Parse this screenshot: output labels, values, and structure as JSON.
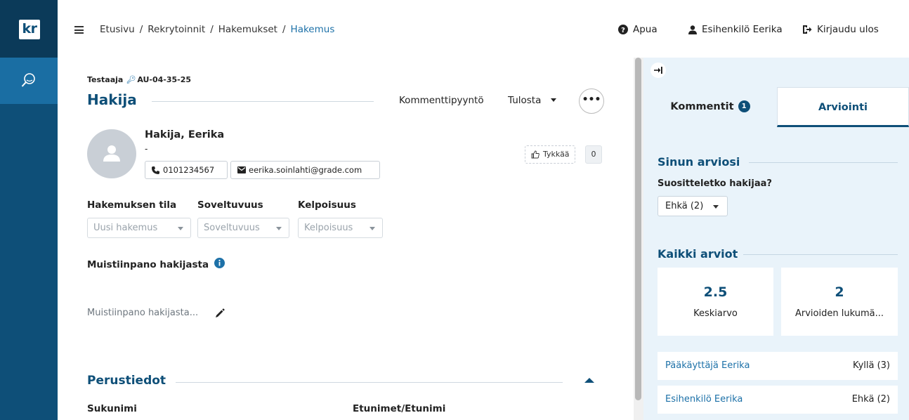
{
  "app": {
    "logo_text": "kr"
  },
  "breadcrumb": {
    "items": [
      "Etusivu",
      "Rekrytoinnit",
      "Hakemukset"
    ],
    "separator": "/",
    "current": "Hakemus"
  },
  "header": {
    "help_label": "Apua",
    "user_label": "Esihenkilö Eerika",
    "logout_label": "Kirjaudu ulos"
  },
  "applicant": {
    "role_label": "Testaaja",
    "code": "AU-04-35-25",
    "section_title": "Hakija",
    "request_comment_label": "Kommenttipyyntö",
    "print_label": "Tulosta",
    "more_label": "•••",
    "name": "Hakija, Eerika",
    "subtitle": "-",
    "phone": "0101234567",
    "email": "eerika.soinlahti@grade.com",
    "like_label": "Tykkää",
    "like_count": "0"
  },
  "status_fields": [
    {
      "label": "Hakemuksen tila",
      "placeholder": "Uusi hakemus"
    },
    {
      "label": "Soveltuvuus",
      "placeholder": "Soveltuvuus"
    },
    {
      "label": "Kelpoisuus",
      "placeholder": "Kelpoisuus"
    }
  ],
  "note": {
    "label": "Muistiinpano hakijasta",
    "placeholder": "Muistiinpano hakijasta..."
  },
  "basic_info": {
    "title": "Perustiedot",
    "columns": [
      "Sukunimi",
      "Etunimet/Etunimi"
    ]
  },
  "side_panel": {
    "tabs": [
      {
        "label": "Kommentit",
        "badge": "1"
      },
      {
        "label": "Arviointi"
      }
    ],
    "your_rating_title": "Sinun arviosi",
    "question": "Suositteletko hakijaa?",
    "selected_rating": "Ehkä (2)",
    "all_ratings_title": "Kaikki arviot",
    "stats": [
      {
        "value": "2.5",
        "label": "Keskiarvo"
      },
      {
        "value": "2",
        "label": "Arvioiden lukumä..."
      }
    ],
    "ratings": [
      {
        "name": "Pääkäyttäjä Eerika",
        "value": "Kyllä (3)"
      },
      {
        "name": "Esihenkilö Eerika",
        "value": "Ehkä (2)"
      }
    ]
  },
  "icons": {
    "menu": "hamburger-icon",
    "search": "search-icon",
    "help": "question-circle-icon",
    "user": "user-icon",
    "logout": "logout-icon",
    "key": "key-icon",
    "phone": "phone-icon",
    "email": "envelope-icon",
    "like": "thumbs-up-icon",
    "info": "info-icon",
    "edit": "pencil-icon",
    "collapse": "collapse-right-icon"
  },
  "colors": {
    "brand": "#0e4f78",
    "accent": "#1d71a8",
    "side_bg": "#e9f3fa"
  }
}
